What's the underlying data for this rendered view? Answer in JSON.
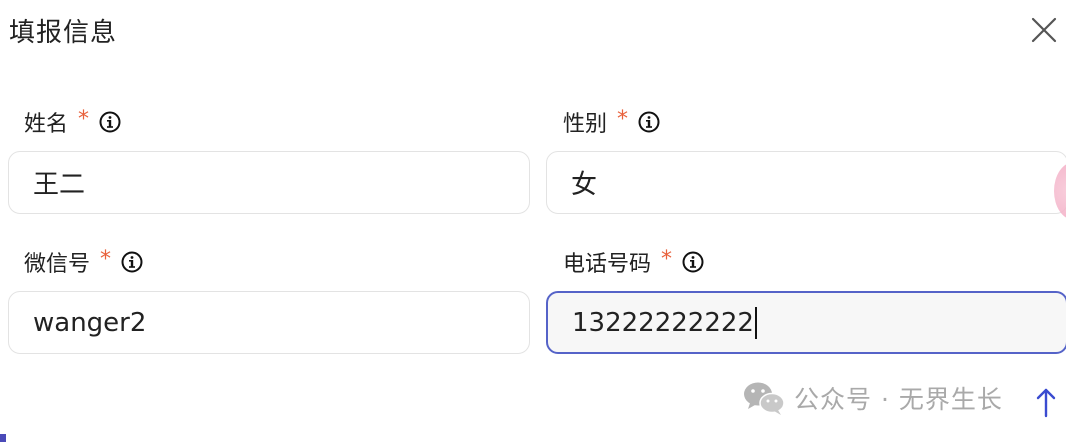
{
  "dialog": {
    "title": "填报信息"
  },
  "fields": [
    {
      "label": "姓名",
      "required_mark": "*",
      "value": "王二"
    },
    {
      "label": "性别",
      "required_mark": "*",
      "value": "女"
    },
    {
      "label": "微信号",
      "required_mark": "*",
      "value": "wanger2"
    },
    {
      "label": "电话号码",
      "required_mark": "*",
      "value": "13222222222"
    }
  ],
  "icons": {
    "close": "close-icon",
    "info": "info-icon",
    "wechat": "wechat-icon",
    "scroll_up": "arrow-up-icon"
  },
  "watermark": {
    "text": "公众号 · 无界生长"
  },
  "colors": {
    "required": "#e8613c",
    "focus_border": "#5563c8",
    "input_border": "#e3e3e3"
  }
}
